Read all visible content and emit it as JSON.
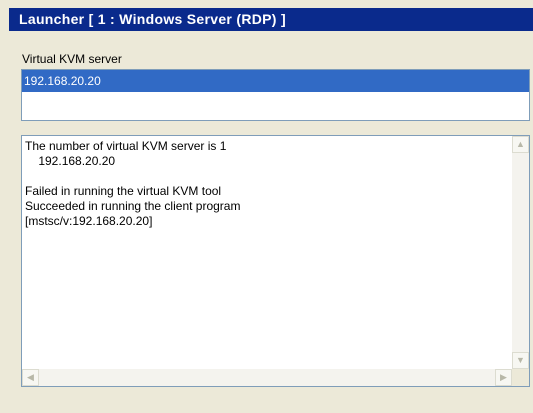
{
  "window": {
    "title": "Launcher [ 1 : Windows Server (RDP) ]"
  },
  "server_section": {
    "label": "Virtual KVM server",
    "items": [
      "192.168.20.20"
    ],
    "selected_index": 0
  },
  "output": {
    "lines": [
      "The number of virtual KVM server is 1",
      "    192.168.20.20",
      "",
      "Failed in running the virtual KVM tool",
      "Succeeded in running the client program",
      "[mstsc/v:192.168.20.20]"
    ]
  },
  "icons": {
    "scroll_up": "scroll-up-arrow-icon",
    "scroll_down": "scroll-down-arrow-icon",
    "scroll_left": "scroll-left-arrow-icon",
    "scroll_right": "scroll-right-arrow-icon"
  },
  "colors": {
    "title_bar": "#0a2a8c",
    "selection": "#316ac5",
    "background": "#ece9d8"
  }
}
